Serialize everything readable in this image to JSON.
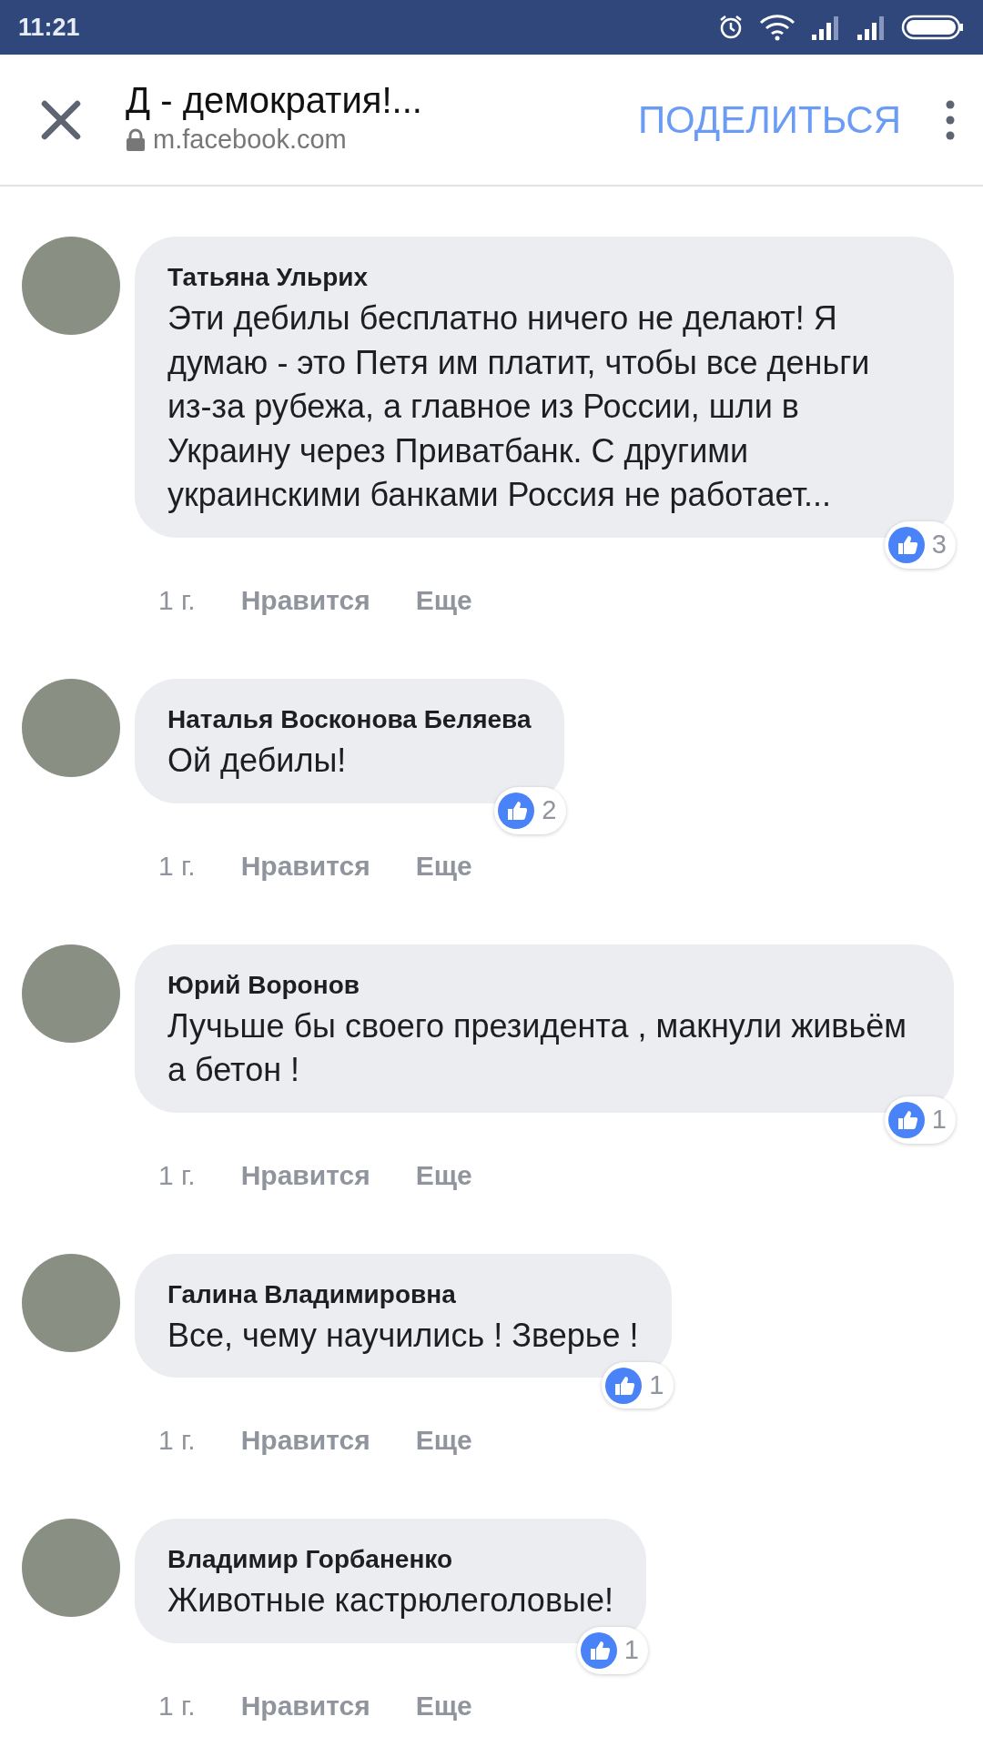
{
  "status_bar": {
    "time": "11:21"
  },
  "header": {
    "title": "Д - демократия!...",
    "url": "m.facebook.com",
    "share": "ПОДЕЛИТЬСЯ"
  },
  "comments": [
    {
      "author": "Татьяна Ульрих",
      "text": "Эти дебилы бесплатно ничего не делают! Я думаю - это Петя им платит, чтобы все деньги из-за рубежа, а главное из России, шли в Украину через Приватбанк. С другими украинскими банками Россия не работает...",
      "likes": "3",
      "age": "1 г.",
      "like": "Нравится",
      "more": "Еще"
    },
    {
      "author": "Наталья Восконова Беляева",
      "text": "Ой дебилы!",
      "likes": "2",
      "age": "1 г.",
      "like": "Нравится",
      "more": "Еще"
    },
    {
      "author": "Юрий Воронов",
      "text": "Лучьше бы своего президента , макнули живьём а бетон !",
      "likes": "1",
      "age": "1 г.",
      "like": "Нравится",
      "more": "Еще"
    },
    {
      "author": "Галина Владимировна",
      "text": "Все, чему научились ! Зверье !",
      "likes": "1",
      "age": "1 г.",
      "like": "Нравится",
      "more": "Еще"
    },
    {
      "author": "Владимир Горбаненко",
      "text": "Животные кастрюлеголовые!",
      "likes": "1",
      "age": "1 г.",
      "like": "Нравится",
      "more": "Еще"
    }
  ]
}
